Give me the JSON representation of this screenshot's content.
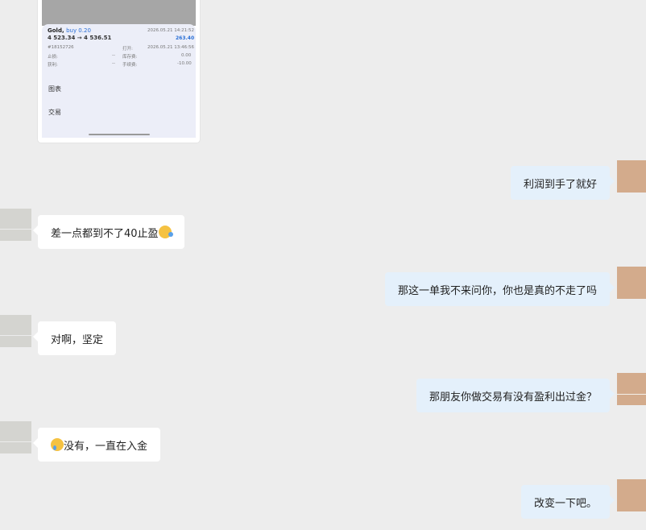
{
  "trade_card": {
    "symbol": "Gold,",
    "side": "buy 0.20",
    "price_line": "4 523.34 → 4 536.51",
    "close_time": "2026.05.21 14:21:52",
    "profit": "263.40",
    "order_id": "#18152726",
    "open_label": "打开:",
    "open_time": "2026.05.21 13:46:56",
    "sl_label": "止损:",
    "sl_value": "--",
    "swap_label": "库存费:",
    "swap_value": "0.00",
    "tp_label": "获利:",
    "tp_value": "--",
    "fee_label": "手续费:",
    "fee_value": "-10.00",
    "menu_chart": "图表",
    "menu_trade": "交易"
  },
  "messages": [
    {
      "side": "right",
      "text": "利润到手了就好"
    },
    {
      "side": "left",
      "text": "差一点都到不了40止盈",
      "emoji": "rolling-laugh"
    },
    {
      "side": "right",
      "text": "那这一单我不来问你，你也是真的不走了吗"
    },
    {
      "side": "left",
      "text": "对啊，坚定"
    },
    {
      "side": "right",
      "text": "那朋友你做交易有没有盈利出过金？"
    },
    {
      "side": "left",
      "text": "没有，一直在入金",
      "emoji": "crying-face"
    },
    {
      "side": "right",
      "text": "改变一下吧。"
    }
  ],
  "colors": {
    "background": "#ededed",
    "bubble_left": "#ffffff",
    "bubble_right": "#e4f0fb",
    "avatar_self": "#d3ab8c",
    "avatar_peer": "#d4d4d0",
    "accent_blue": "#2a6fd6"
  }
}
